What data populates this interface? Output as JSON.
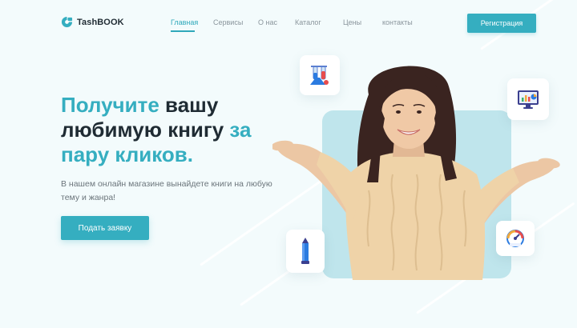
{
  "header": {
    "logo_text": "TashBOOK",
    "nav": [
      {
        "label": "Главная",
        "active": true
      },
      {
        "label": "Сервисы",
        "active": false
      },
      {
        "label": "О нас",
        "active": false
      },
      {
        "label": "Каталог",
        "active": false
      },
      {
        "label": "Цены",
        "active": false
      },
      {
        "label": "контакты",
        "active": false
      }
    ],
    "register_label": "Регистрация"
  },
  "hero": {
    "headline": {
      "line1_accent": "Получите",
      "line1_rest": " вашу",
      "line2_rest": "любимую книгу ",
      "line2_accent": "за",
      "line3_accent": "пару кликов."
    },
    "lead": "В нашем онлайн магазине вынайдете книги на любую тему и жанра!",
    "cta_label": "Подать заявку"
  },
  "icons": [
    "lab-flasks-icon",
    "monitor-chart-icon",
    "pencil-icon",
    "speedometer-icon"
  ],
  "colors": {
    "accent": "#35aec0",
    "background": "#f3fbfc",
    "heading": "#1f2b33",
    "photo_panel": "#bfe5ec"
  }
}
